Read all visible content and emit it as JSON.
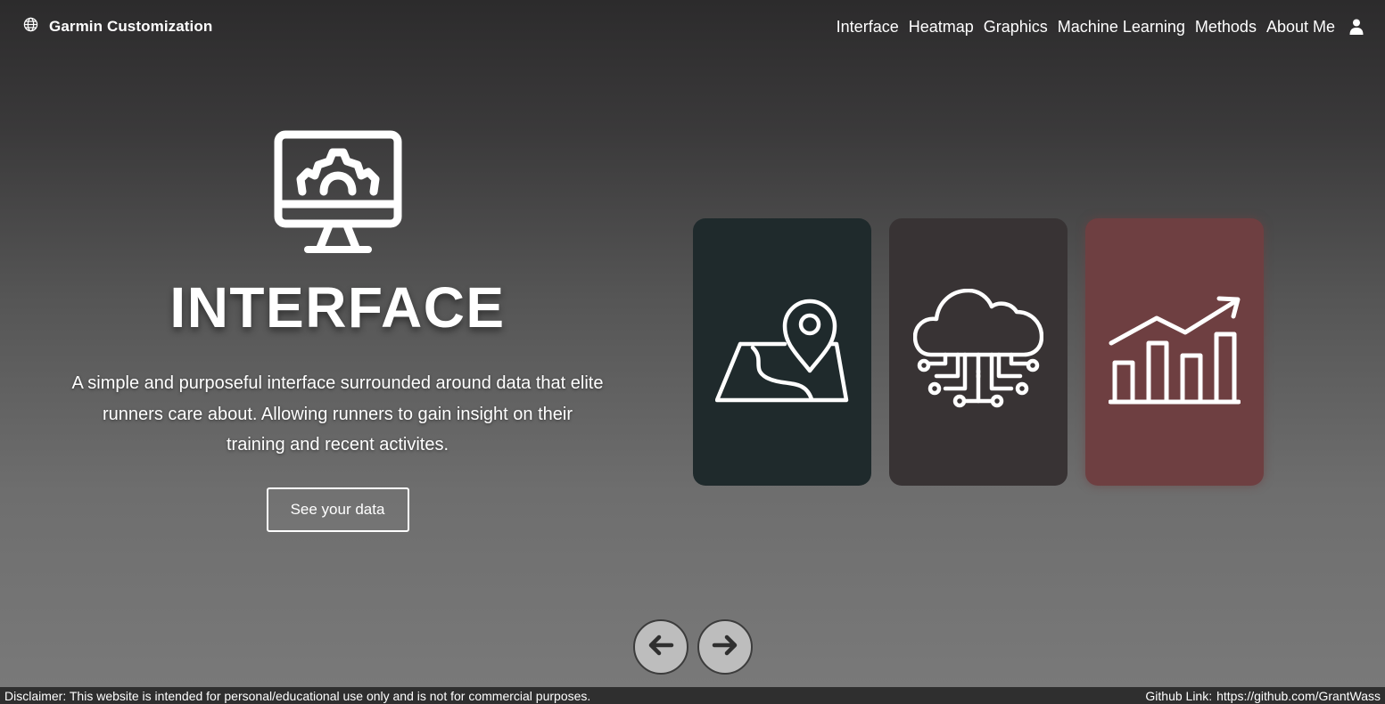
{
  "brand": {
    "title": "Garmin Customization",
    "icon": "globe-icon"
  },
  "nav": {
    "links": [
      "Interface",
      "Heatmap",
      "Graphics",
      "Machine Learning",
      "Methods",
      "About Me"
    ],
    "user_icon": "user-icon"
  },
  "hero": {
    "icon": "monitor-gear-icon",
    "title": "INTERFACE",
    "description": "A simple and purposeful interface surrounded around data that elite runners care about. Allowing runners to gain insight on their training and recent activites.",
    "button_label": "See your data"
  },
  "cards": [
    {
      "icon": "map-pin-icon",
      "color": "#1f2a2c"
    },
    {
      "icon": "cloud-network-icon",
      "color": "#383334"
    },
    {
      "icon": "bar-chart-growth-icon",
      "color": "#6e3f41"
    }
  ],
  "carousel": {
    "prev_icon": "arrow-left-icon",
    "next_icon": "arrow-right-icon"
  },
  "footer": {
    "disclaimer": "Disclaimer: This website is intended for personal/educational use only and is not for commercial purposes.",
    "github_label": "Github Link:",
    "github_url": "https://github.com/GrantWass"
  }
}
